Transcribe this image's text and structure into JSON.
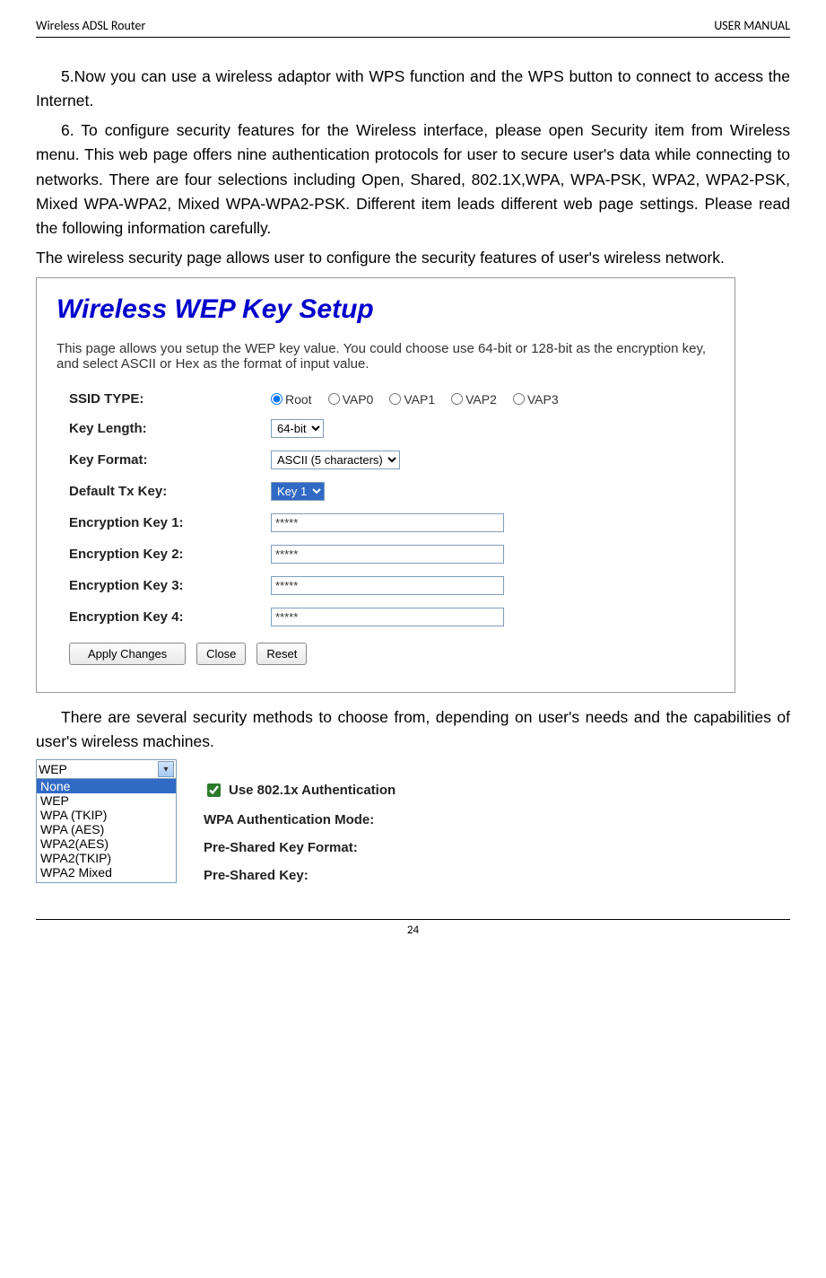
{
  "header": {
    "left": "Wireless ADSL Router",
    "right": "USER MANUAL"
  },
  "para5": "5.Now you can use a wireless adaptor with WPS function and the WPS button to connect   to access the Internet.",
  "para6": "6. To configure security features for the Wireless interface, please open Security item from Wireless menu. This web page offers nine authentication protocols for user to secure user's data while connecting to networks. There are four selections including Open, Shared, 802.1X,WPA, WPA-PSK, WPA2, WPA2-PSK, Mixed WPA-WPA2, Mixed WPA-WPA2-PSK. Different item leads different web page settings. Please read the following information carefully.",
  "para6b": "The wireless security page allows user to configure the security features of user's wireless network.",
  "wep": {
    "title": "Wireless WEP Key Setup",
    "desc": "This page allows you setup the WEP key value. You could choose use 64-bit or 128-bit as the encryption key, and select ASCII or Hex as the format of input value.",
    "ssid_label": "SSID TYPE:",
    "ssid_options": [
      "Root",
      "VAP0",
      "VAP1",
      "VAP2",
      "VAP3"
    ],
    "keylen_label": "Key Length:",
    "keylen_value": "64-bit",
    "keyfmt_label": "Key Format:",
    "keyfmt_value": "ASCII (5 characters)",
    "txkey_label": "Default Tx Key:",
    "txkey_value": "Key 1",
    "enc1_label": "Encryption Key 1:",
    "enc2_label": "Encryption Key 2:",
    "enc3_label": "Encryption Key 3:",
    "enc4_label": "Encryption Key 4:",
    "enc_mask": "*****",
    "btn_apply": "Apply Changes",
    "btn_close": "Close",
    "btn_reset": "Reset"
  },
  "para7": "There are several security methods to choose from, depending on user's needs and the capabilities of user's wireless machines.",
  "dropdown": {
    "current": "WEP",
    "items": [
      "None",
      "WEP",
      "WPA (TKIP)",
      "WPA (AES)",
      "WPA2(AES)",
      "WPA2(TKIP)",
      "WPA2 Mixed"
    ]
  },
  "auth": {
    "use8021x": "Use 802.1x Authentication",
    "wpa_mode": "WPA Authentication Mode:",
    "psk_format": "Pre-Shared Key Format:",
    "psk": "Pre-Shared Key:"
  },
  "page_number": "24"
}
